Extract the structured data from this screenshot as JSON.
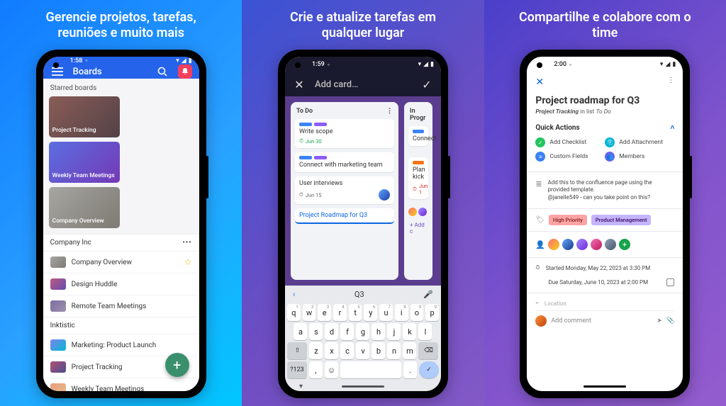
{
  "panels": {
    "p1": {
      "headline": "Gerencie projetos, tarefas,\nreuniões e muito mais"
    },
    "p2": {
      "headline": "Crie e atualize tarefas em\nqualquer lugar"
    },
    "p3": {
      "headline": "Compartilhe e colabore com o\ntime"
    }
  },
  "phone1": {
    "status_time": "1:58",
    "appbar_title": "Boards",
    "sections": {
      "starred_label": "Starred boards",
      "starred": [
        {
          "name": "Project Tracking"
        },
        {
          "name": "Weekly Team Meetings"
        },
        {
          "name": "Company Overview"
        }
      ],
      "workspace1": {
        "name": "Company Inc",
        "boards": [
          {
            "name": "Company Overview",
            "starred": true
          },
          {
            "name": "Design Huddle",
            "starred": false
          },
          {
            "name": "Remote Team Meetings",
            "starred": false
          }
        ]
      },
      "workspace2": {
        "name": "Inktistic",
        "boards": [
          {
            "name": "Marketing: Product Launch"
          },
          {
            "name": "Project Tracking"
          },
          {
            "name": "Weekly Team Meetings"
          }
        ]
      }
    }
  },
  "phone2": {
    "status_time": "1:59",
    "appbar_placeholder": "Add card…",
    "columns": {
      "todo": {
        "title": "To Do",
        "cards": [
          {
            "title": "Write scope",
            "due": "Jun 30",
            "done": true
          },
          {
            "title": "Connect with marketing team"
          },
          {
            "title": "User interviews",
            "due": "Jun 15"
          }
        ],
        "new_card_text": "Project Roadmap for Q3"
      },
      "inprog": {
        "title": "In Progr",
        "cards": [
          {
            "title": "Connect"
          },
          {
            "title": "Plan kick",
            "due": "Jun 1"
          }
        ],
        "add_label": "+ Add c"
      }
    },
    "keyboard": {
      "suggestion": "Q3",
      "row1": [
        "q",
        "w",
        "e",
        "r",
        "t",
        "y",
        "u",
        "i",
        "o",
        "p"
      ],
      "row2": [
        "a",
        "s",
        "d",
        "f",
        "g",
        "h",
        "j",
        "k",
        "l"
      ],
      "row3_shift": "⇧",
      "row3": [
        "z",
        "x",
        "c",
        "v",
        "b",
        "n",
        "m"
      ],
      "row3_back": "⌫",
      "row4_sym": "?123",
      "row4_comma": ",",
      "row4_emoji": "☺",
      "row4_period": ".",
      "row4_enter": "✓"
    }
  },
  "phone3": {
    "status_time": "2:00",
    "title": "Project roadmap for Q3",
    "subtitle_board": "Project Tracking",
    "subtitle_mid": " in list ",
    "subtitle_list": "To Do",
    "quick_actions_label": "Quick Actions",
    "quick_actions": {
      "checklist": "Add Checklist",
      "attachment": "Add Attachment",
      "custom_fields": "Custom Fields",
      "members": "Members"
    },
    "description": "Add this to the confluence page using the provided template.\n@janelle549 - can you take point on this?",
    "mention": "@janelle549",
    "labels": {
      "hp": "High Priority",
      "pm": "Product Management"
    },
    "dates": {
      "start": "Started Monday, May 22, 2023 at 3:30 PM",
      "due": "Due Saturday, June 10, 2023 at 2:00 PM"
    },
    "location_label": "Location",
    "comment_placeholder": "Add comment"
  }
}
